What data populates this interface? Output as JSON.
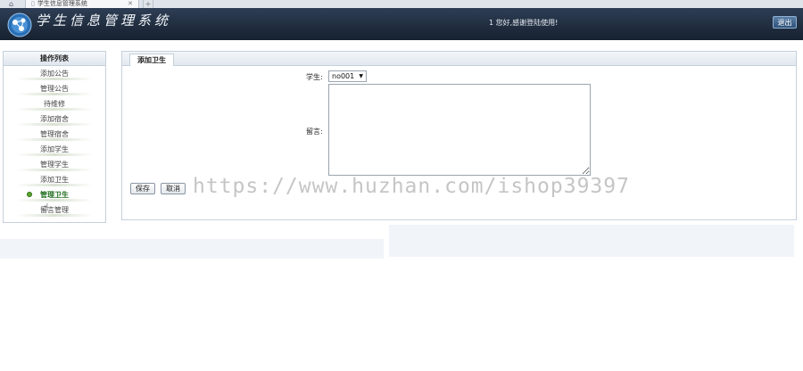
{
  "browser": {
    "tab_title": "学生信息管理系统",
    "close_glyph": "✕",
    "new_tab_glyph": "+",
    "home_glyph": "⌂"
  },
  "header": {
    "app_title": "学生信息管理系统",
    "welcome_text": "1 您好,感谢登陆使用!",
    "logout_label": "退出"
  },
  "sidebar": {
    "title": "操作列表",
    "items": [
      {
        "label": "添加公告",
        "active": false
      },
      {
        "label": "管理公告",
        "active": false
      },
      {
        "label": "待维修",
        "active": false
      },
      {
        "label": "添加宿舍",
        "active": false
      },
      {
        "label": "管理宿舍",
        "active": false
      },
      {
        "label": "添加学生",
        "active": false
      },
      {
        "label": "管理学生",
        "active": false
      },
      {
        "label": "添加卫生",
        "active": false
      },
      {
        "label": "管理卫生",
        "active": true
      },
      {
        "label": "留言管理",
        "active": false
      }
    ]
  },
  "main": {
    "tab_label": "添加卫生",
    "form": {
      "student_label": "学生:",
      "student_value": "no001",
      "message_label": "留言:",
      "message_value": "",
      "save_label": "保存",
      "cancel_label": "取消"
    }
  },
  "watermark": "https://www.huzhan.com/ishop39397",
  "colors": {
    "header_bg": "#1f2b3c",
    "active_item": "#1f6e1f",
    "border": "#c5d0dc"
  }
}
